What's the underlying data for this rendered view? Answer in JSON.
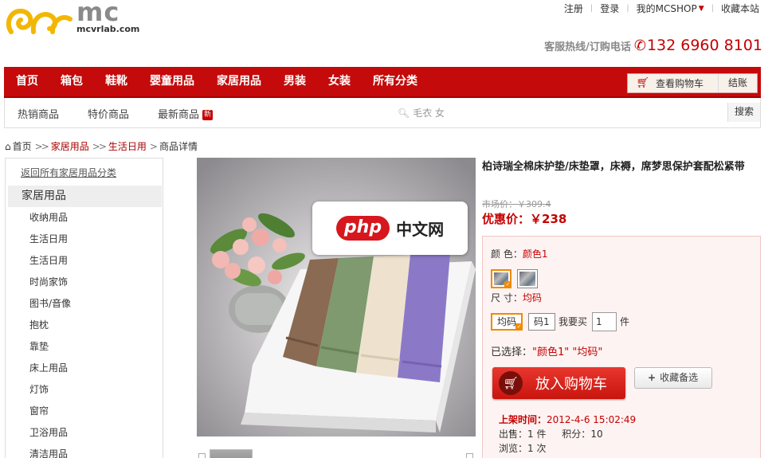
{
  "header": {
    "brand": "mc",
    "domain": "mcvrlab.com",
    "top_links": [
      "注册",
      "登录",
      "我的MCSHOP",
      "收藏本站"
    ],
    "hotline_label": "客服热线/订购电话",
    "hotline_number": "132 6960 8101"
  },
  "main_nav": {
    "items": [
      "首页",
      "箱包",
      "鞋靴",
      "婴童用品",
      "家居用品",
      "男装",
      "女装",
      "所有分类"
    ],
    "view_cart": "查看购物车",
    "checkout": "结账"
  },
  "sub_nav": {
    "items": [
      "热销商品",
      "特价商品",
      "最新商品"
    ],
    "new_badge": "新",
    "search_placeholder": "毛衣 女",
    "search_button": "搜索"
  },
  "breadcrumb": {
    "home": "首页",
    "level1": "家居用品",
    "level2": "生活日用",
    "current": "商品详情"
  },
  "sidebar": {
    "back_link": "返回所有家居用品分类",
    "category": "家居用品",
    "items": [
      "收纳用品",
      "生活日用",
      "生活日用",
      "时尚家饰",
      "图书/音像",
      "抱枕",
      "靠垫",
      "床上用品",
      "灯饰",
      "窗帘",
      "卫浴用品",
      "清洁用品"
    ]
  },
  "watermark": {
    "pill": "php",
    "text": "中文网"
  },
  "product": {
    "title": "柏诗瑞全棉床护垫/床垫罩，床褥，席梦思保护套配松紧带",
    "market_price": "市场价：￥309.4",
    "sale_price_label": "优惠价：",
    "sale_price": "￥238",
    "color_label": "颜 色：",
    "color_value": "颜色1",
    "size_label": "尺 寸：",
    "size_value": "均码",
    "size_options": [
      "均码",
      "码1"
    ],
    "buy_label": "我要买",
    "quantity": "1",
    "unit": "件",
    "selected_label": "已选择：",
    "selected_value": "\"颜色1\" \"均码\"",
    "add_to_cart": "放入购物车",
    "favorite": "收藏备选",
    "listed_label": "上架时间：",
    "listed_time": "2012-4-6 15:02:49",
    "sold_label": "出售：",
    "sold_value": "1 件",
    "points_label": "积分：",
    "points_value": "10",
    "views_label": "浏览：",
    "views_value": "1 次"
  },
  "colors": {
    "accent": "#c40a0a",
    "price": "#c40000",
    "highlight": "#f08a00"
  }
}
